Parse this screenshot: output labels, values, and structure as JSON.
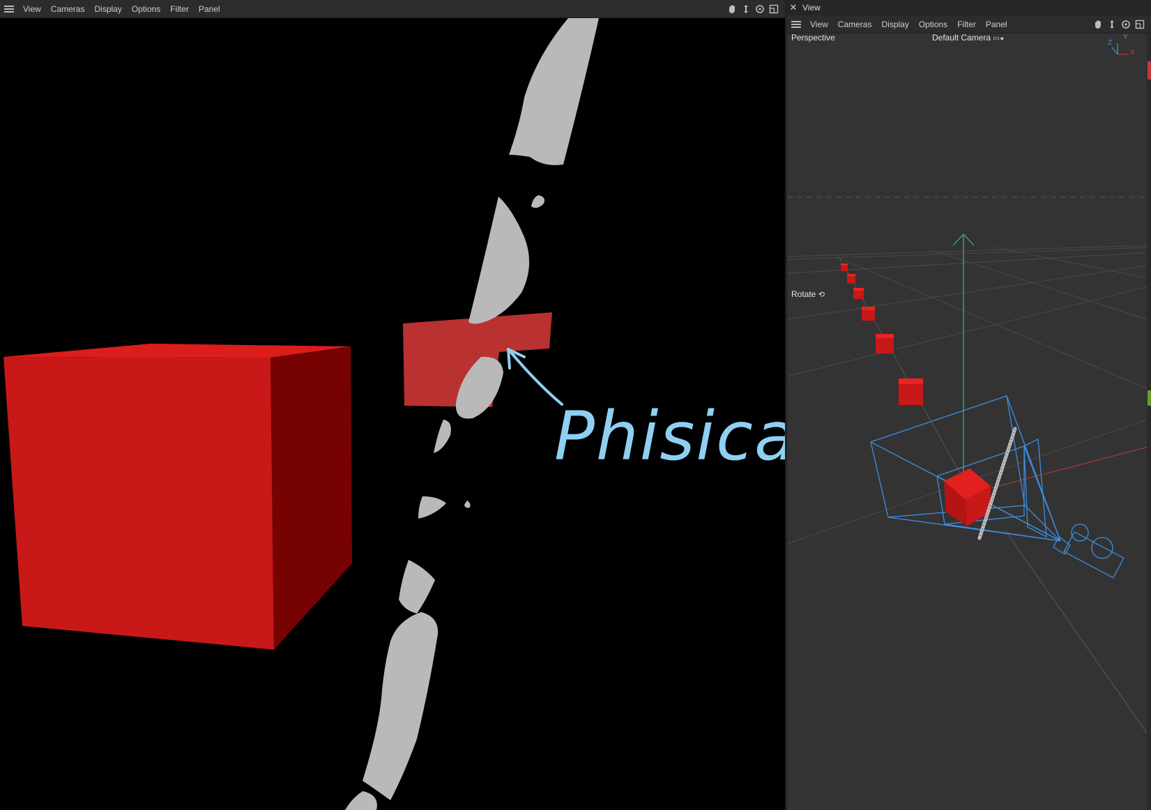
{
  "left_panel": {
    "menu": [
      "View",
      "Cameras",
      "Display",
      "Options",
      "Filter",
      "Panel"
    ],
    "annotation": "Phisical"
  },
  "right_panel": {
    "title": "View",
    "menu": [
      "View",
      "Cameras",
      "Display",
      "Options",
      "Filter",
      "Panel"
    ],
    "projection_label": "Perspective",
    "camera_label": "Default Camera",
    "rotate_label": "Rotate",
    "axis_labels": {
      "x": "X",
      "y": "Y",
      "z": "Z"
    }
  },
  "icons": [
    "hamburger-icon",
    "hand-pan-icon",
    "move-icon",
    "rotate-icon",
    "maximize-icon",
    "close-icon",
    "camera-icon"
  ],
  "colors": {
    "cube_red": "#d11a1a",
    "annotation_blue": "#8fd0f2",
    "camera_blue": "#3d8fe0",
    "viewport_bg": "#333333"
  }
}
